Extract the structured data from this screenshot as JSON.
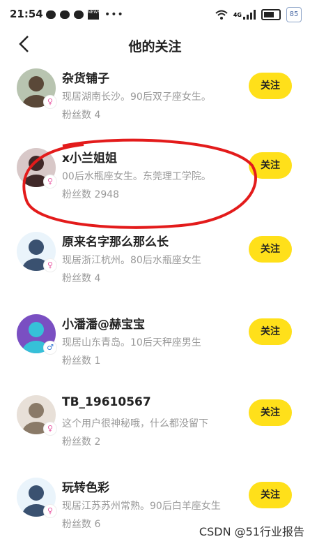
{
  "status_bar": {
    "time": "21:54",
    "news_label": "NEWS",
    "network": "4G",
    "badge": "85"
  },
  "nav": {
    "title": "他的关注"
  },
  "follow_label": "关注",
  "users": [
    {
      "name": "杂货铺子",
      "desc": "现居湖南长沙。90后双子座女生。",
      "fans": "粉丝数 4",
      "gender": "♀"
    },
    {
      "name": "x小兰姐姐",
      "desc": "00后水瓶座女生。东莞理工学院。",
      "fans": "粉丝数 2948",
      "gender": "♀"
    },
    {
      "name": "原来名字那么那么长",
      "desc": "现居浙江杭州。80后水瓶座女生",
      "fans": "粉丝数 4",
      "gender": "♀"
    },
    {
      "name": "小潘潘@赫宝宝",
      "desc": "现居山东青岛。10后天秤座男生",
      "fans": "粉丝数 1",
      "gender": "♂"
    },
    {
      "name": "TB_19610567",
      "desc": "这个用户很神秘哦，什么都没留下",
      "fans": "粉丝数 2",
      "gender": "♀"
    },
    {
      "name": "玩转色彩",
      "desc": "现居江苏苏州常熟。90后白羊座女生",
      "fans": "粉丝数 6",
      "gender": "♀"
    }
  ],
  "watermark": "CSDN @51行业报告",
  "colors": {
    "accent": "#ffe01a",
    "circle": "#e31b1b",
    "female": "#e85aa4",
    "male": "#3a7bd5"
  }
}
